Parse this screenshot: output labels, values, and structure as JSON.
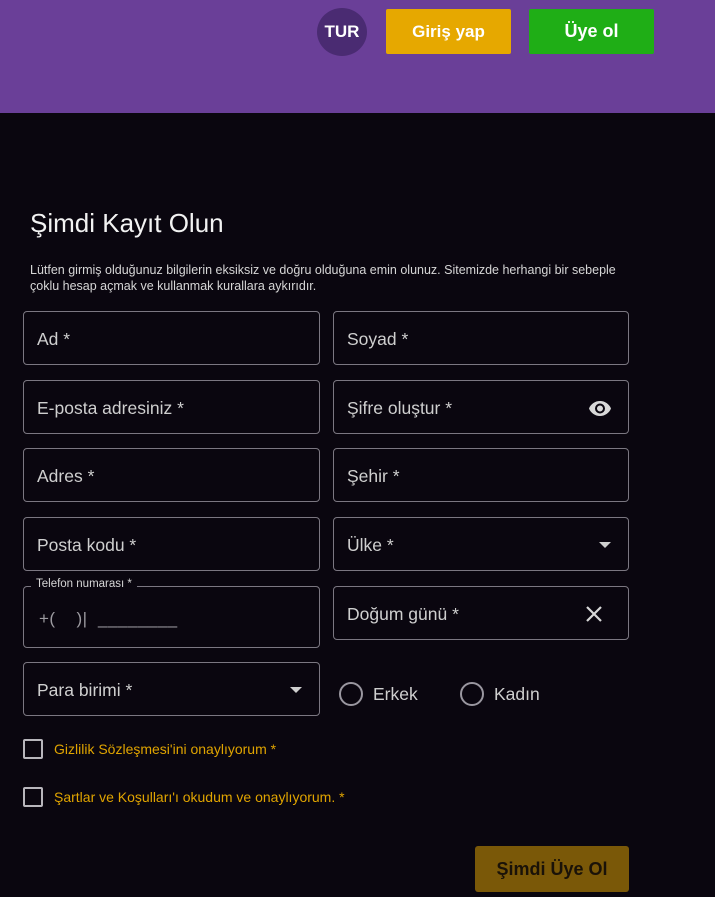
{
  "header": {
    "language": "TUR",
    "login_label": "Giriş yap",
    "signup_label": "Üye ol"
  },
  "form": {
    "title": "Şimdi Kayıt Olun",
    "description": "Lütfen girmiş olduğunuz bilgilerin eksiksiz ve doğru olduğuna emin olunuz. Sitemizde herhangi bir sebeple çoklu hesap açmak ve kullanmak kurallara aykırıdır.",
    "first_name": "Ad *",
    "last_name": "Soyad *",
    "email": "E-posta adresiniz *",
    "password": "Şifre oluştur *",
    "address": "Adres *",
    "city": "Şehir *",
    "postal_code": "Posta kodu *",
    "country": "Ülke *",
    "phone_label": "Telefon numarası *",
    "phone_mask": "+(    )|  ________",
    "birthday": "Doğum günü *",
    "currency": "Para birimi *",
    "gender_male": "Erkek",
    "gender_female": "Kadın",
    "privacy_check": "Gizlilik Sözleşmesi'ini onaylıyorum *",
    "terms_check": "Şartlar ve Koşulları'ı okudum ve onaylıyorum. *",
    "submit_label": "Şimdi Üye Ol"
  },
  "icons": {
    "password_toggle": "eye-icon",
    "country_dropdown": "caret-down-icon",
    "birthday_clear": "close-icon",
    "currency_dropdown": "caret-down-icon"
  },
  "colors": {
    "header_bg": "#6a3f98",
    "login_button": "#e6a800",
    "signup_button": "#1fae16",
    "submit_button": "#7a5808",
    "page_bg": "#0a060f",
    "accent_text": "#e0a400"
  }
}
